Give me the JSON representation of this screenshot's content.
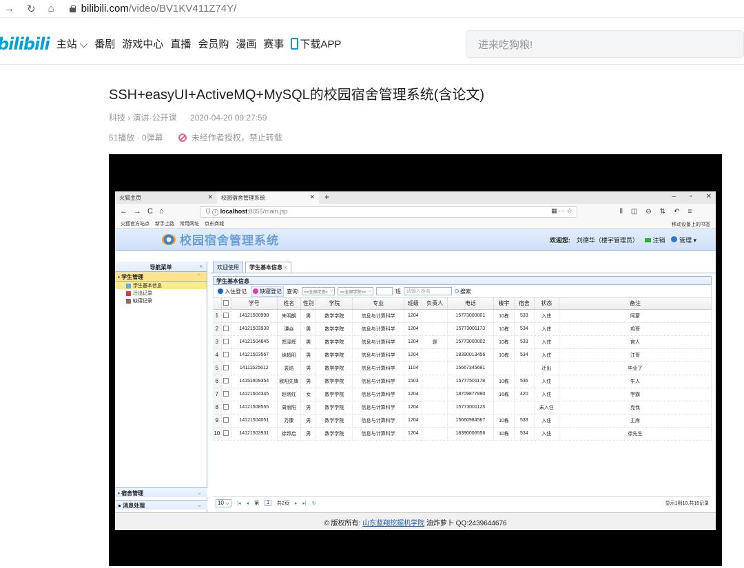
{
  "browser": {
    "domain": "bilibili.com",
    "path": "/video/BV1KV411Z74Y/"
  },
  "bili": {
    "logo": "bilibili",
    "nav": [
      "主站",
      "番剧",
      "游戏中心",
      "直播",
      "会员购",
      "漫画",
      "赛事",
      "下载APP"
    ],
    "search_placeholder": "进来吃狗粮!"
  },
  "video": {
    "title": "SSH+easyUI+ActiveMQ+MySQL的校园宿舍管理系统(含论文)",
    "category": "科技 › 演讲·公开课",
    "date": "2020-04-20 09:27:59",
    "stats": "51播放 · 0弹幕",
    "notice": "未经作者授权，禁止转载"
  },
  "inner_browser": {
    "tabs": [
      "火狐主页",
      "校园宿舍管理系统"
    ],
    "url_host": "localhost",
    "url_rest": ":8055/main.jsp",
    "bookmarks": [
      "火狐官方站点",
      "新手上路",
      "常用网址",
      "京东商城"
    ],
    "bookmark_right": "移动设备上的书签"
  },
  "app": {
    "title": "校园宿舍管理系统",
    "welcome_label": "欢迎您:",
    "welcome_user": "刘德华（楼宇管理员）",
    "logout": "注销",
    "manage": "管理 ▾",
    "sidebar_title": "导航菜单",
    "student_group": "学生管理",
    "student_items": [
      "学生基本信息",
      "迁出记录",
      "缺寝记录"
    ],
    "bottom_groups": [
      "宿舍管理",
      "消息处理"
    ],
    "tabs": [
      "欢迎使用",
      "学生基本信息"
    ],
    "panel_title": "学生基本信息",
    "toolbar": {
      "checkin": "入住登记",
      "absence": "缺寝登记",
      "query": "查询:",
      "status_select": "==全部状态=",
      "college_select": "==全部学院==",
      "class_label": "班",
      "name_placeholder": "请输入姓名",
      "search": "搜索"
    },
    "columns": [
      "学号",
      "姓名",
      "性别",
      "学院",
      "专业",
      "班级",
      "负责人",
      "电话",
      "楼宇",
      "宿舍",
      "状态",
      "备注"
    ],
    "rows": [
      [
        "1",
        "14121500998",
        "朱明朗",
        "男",
        "数学学院",
        "信息与计算科学",
        "1204",
        "",
        "15773000001",
        "10栋",
        "533",
        "入住",
        "阿蒙"
      ],
      [
        "2",
        "14121503938",
        "谭焱",
        "男",
        "数学学院",
        "信息与计算科学",
        "1204",
        "",
        "15773001173",
        "10栋",
        "534",
        "入住",
        "鸡哥"
      ],
      [
        "3",
        "14121504645",
        "郑泽辉",
        "男",
        "数学学院",
        "信息与计算科学",
        "1204",
        "是",
        "15773000002",
        "10栋",
        "533",
        "入住",
        "官人"
      ],
      [
        "4",
        "14121503567",
        "徐超阳",
        "男",
        "数学学院",
        "信息与计算科学",
        "1204",
        "",
        "18390013456",
        "10栋",
        "534",
        "入住",
        "江哥"
      ],
      [
        "5",
        "14111525612",
        "袁焰",
        "男",
        "数学学院",
        "信息与计算科学",
        "1104",
        "",
        "15667345691",
        "",
        "",
        "迁出",
        "毕业了"
      ],
      [
        "6",
        "14151609354",
        "欧阳先锋",
        "男",
        "数学学院",
        "信息与计算科学",
        "1503",
        "",
        "15777501178",
        "10栋",
        "536",
        "入住",
        "牛人"
      ],
      [
        "7",
        "14121504345",
        "赵晓红",
        "女",
        "数学学院",
        "信息与计算科学",
        "1204",
        "",
        "18709877890",
        "16栋",
        "420",
        "入住",
        "学霸"
      ],
      [
        "8",
        "14121508555",
        "周丽阳",
        "男",
        "数学学院",
        "信息与计算科学",
        "1204",
        "",
        "15773001123",
        "",
        "",
        "未入住",
        "克伐"
      ],
      [
        "9",
        "14121504051",
        "万康",
        "男",
        "数学学院",
        "信息与计算科学",
        "1204",
        "",
        "15660984567",
        "10栋",
        "533",
        "入住",
        "主席"
      ],
      [
        "10",
        "14121503931",
        "徐邦启",
        "男",
        "数学学院",
        "信息与计算科学",
        "1204",
        "",
        "18390006556",
        "10栋",
        "534",
        "入住",
        "徐先生"
      ]
    ],
    "pager": {
      "page_size": "10",
      "page_label": "第",
      "page_num": "1",
      "total_pages": "共2页",
      "info": "显示1到10,共16记录"
    },
    "footer": {
      "prefix": "© 版权所有:",
      "link": "山东蓝翔挖掘机学院",
      "suffix": "油炸萝卜  QQ:2439644676"
    }
  }
}
